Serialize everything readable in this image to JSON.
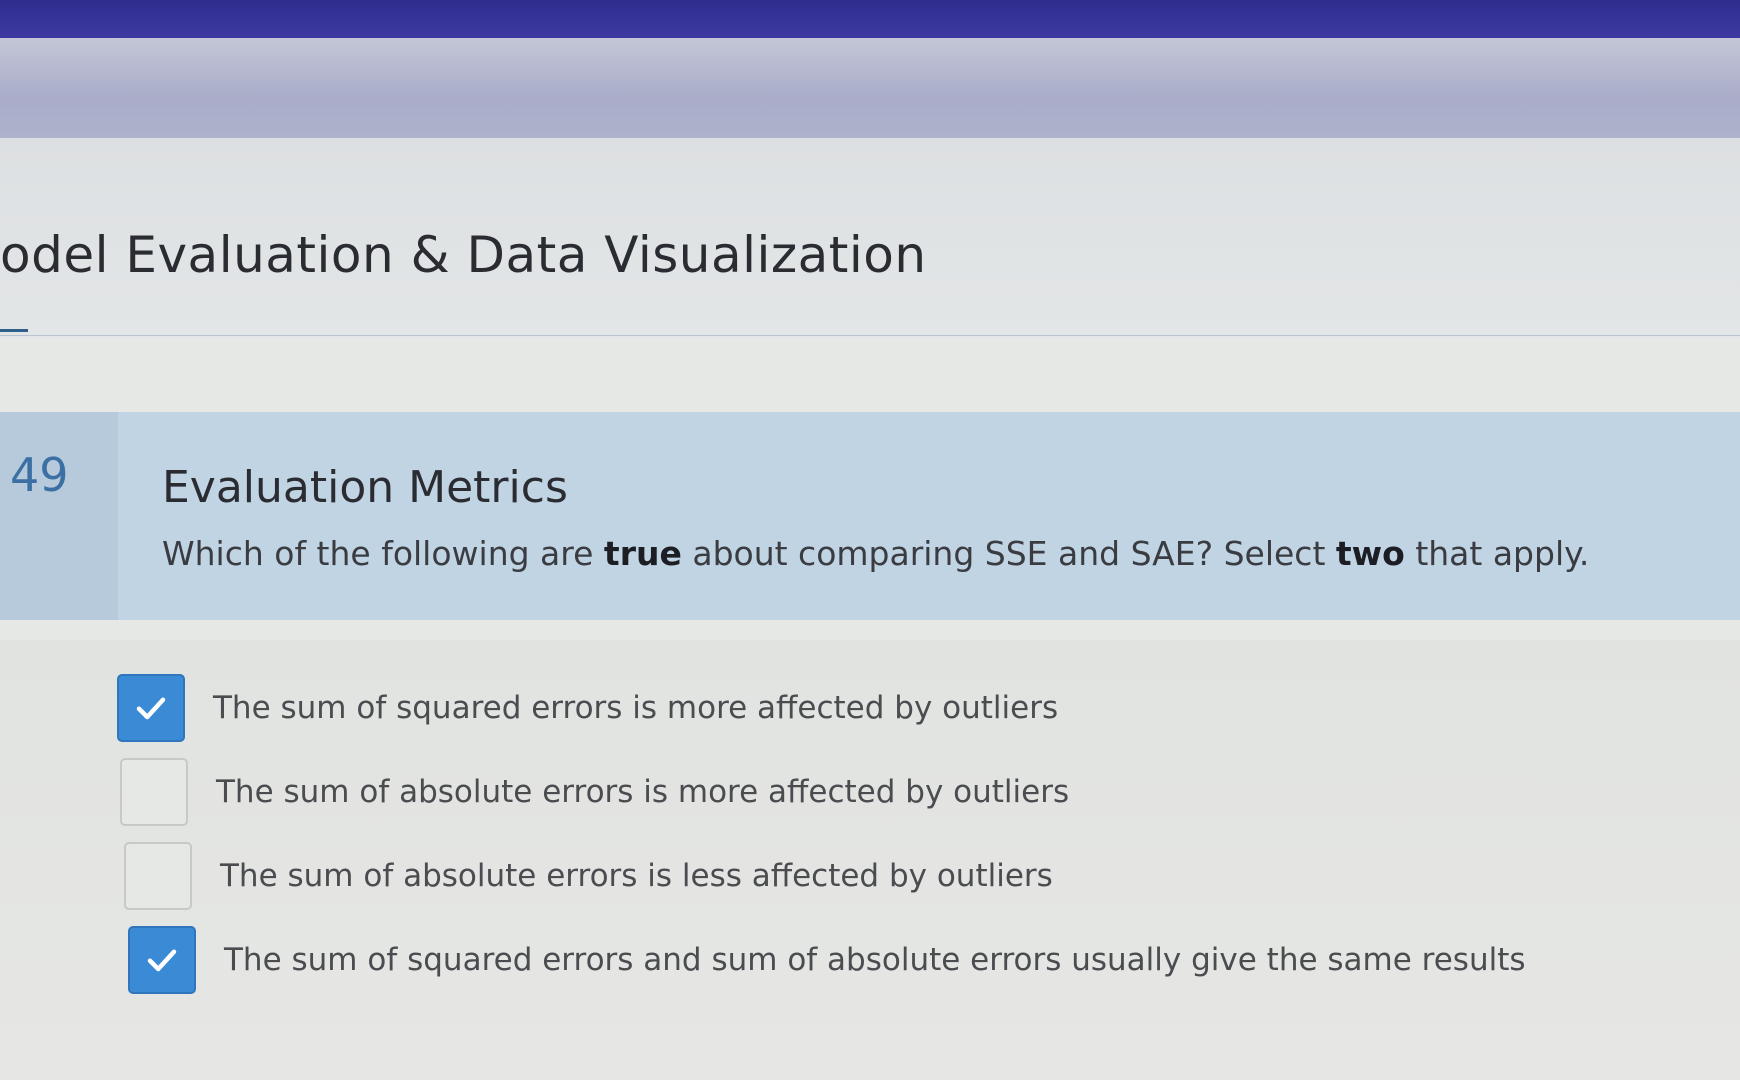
{
  "header": {
    "module_title": "odel Evaluation & Data Visualization"
  },
  "question": {
    "number": "49",
    "title": "Evaluation Metrics",
    "prompt_parts": {
      "p1": "Which of the following are ",
      "b1": "true",
      "p2": " about comparing SSE and SAE? Select ",
      "b2": "two",
      "p3": " that apply."
    }
  },
  "options": [
    {
      "label": "The sum of squared errors is more affected by outliers",
      "checked": true
    },
    {
      "label": "The sum of absolute errors is more affected by outliers",
      "checked": false
    },
    {
      "label": "The sum of absolute errors is less affected by outliers",
      "checked": false
    },
    {
      "label": "The sum of squared errors and sum of absolute errors usually give the same results",
      "checked": true
    }
  ],
  "colors": {
    "top_bar": "#2f2d8e",
    "question_band": "#c1d4e4",
    "checkbox_checked": "#3b8ad6",
    "question_number": "#3c6fa3"
  },
  "icons": {
    "check": "check-icon"
  }
}
